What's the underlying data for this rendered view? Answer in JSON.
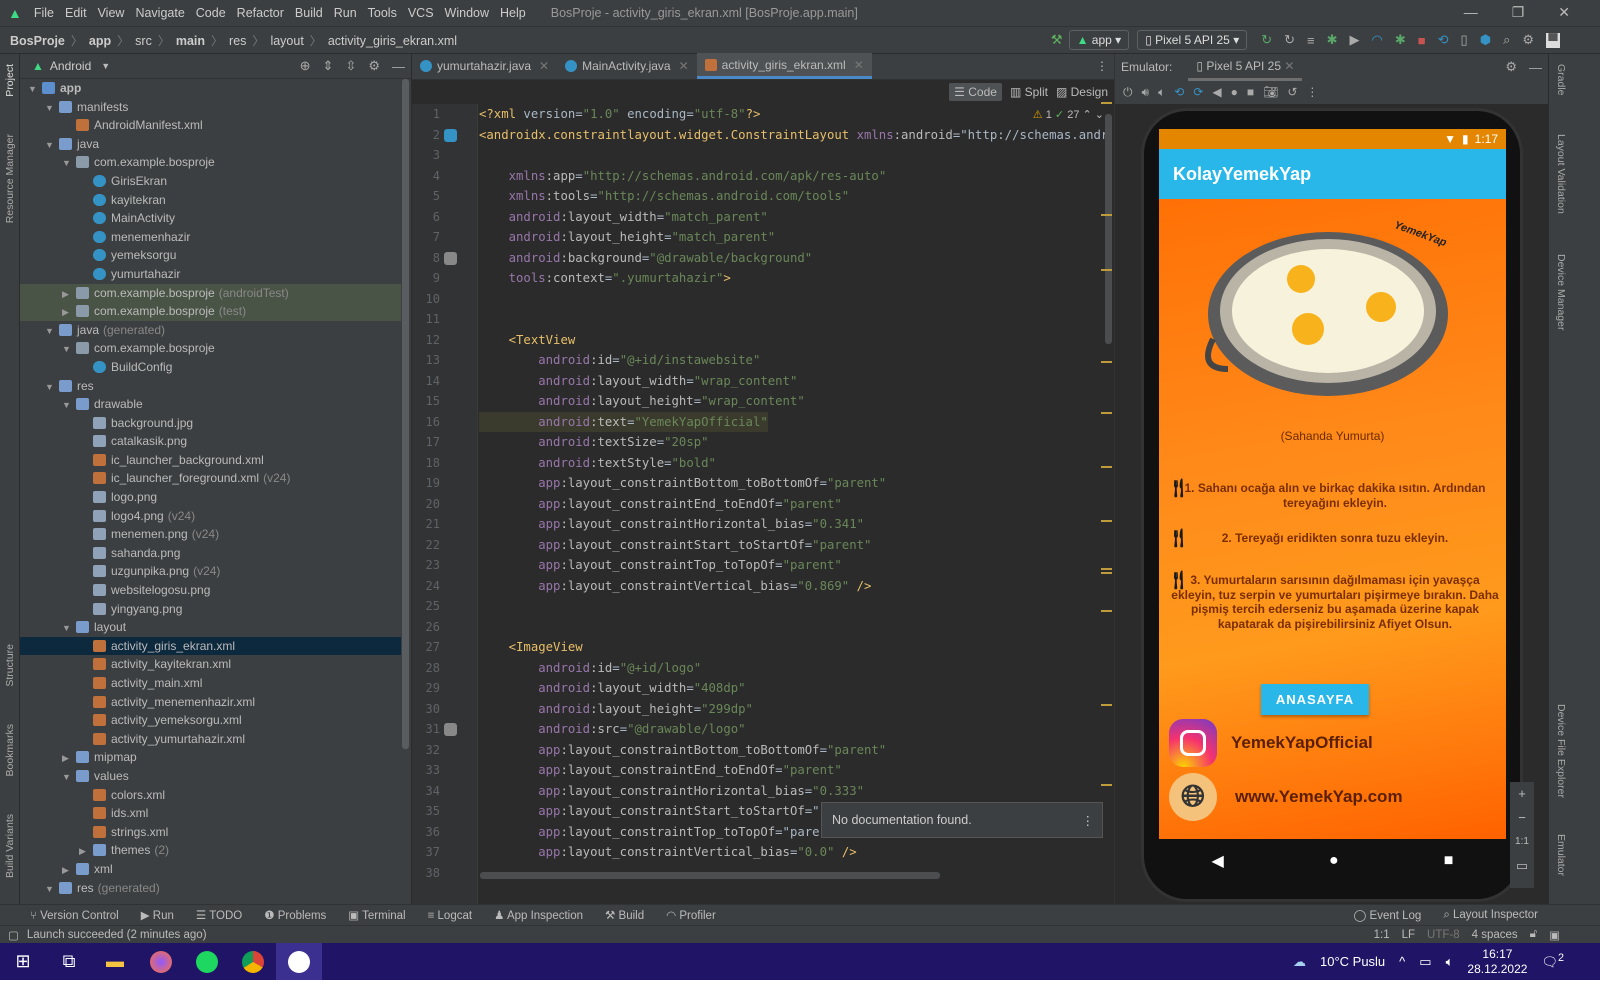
{
  "menu": [
    "File",
    "Edit",
    "View",
    "Navigate",
    "Code",
    "Refactor",
    "Build",
    "Run",
    "Tools",
    "VCS",
    "Window",
    "Help"
  ],
  "window_title": "BosProje - activity_giris_ekran.xml [BosProje.app.main]",
  "breadcrumb": [
    "BosProje",
    "app",
    "src",
    "main",
    "res",
    "layout",
    "activity_giris_ekran.xml"
  ],
  "run_config": "app",
  "device": "Pixel 5 API 25",
  "project_panel": {
    "view": "Android",
    "side_tabs": [
      "Project",
      "Resource Manager",
      "Structure",
      "Bookmarks",
      "Build Variants"
    ]
  },
  "tree": [
    {
      "d": 0,
      "a": "v",
      "t": "app",
      "ic": "module",
      "b": true
    },
    {
      "d": 1,
      "a": "v",
      "t": "manifests",
      "ic": "folder"
    },
    {
      "d": 2,
      "a": "",
      "t": "AndroidManifest.xml",
      "ic": "xml"
    },
    {
      "d": 1,
      "a": "v",
      "t": "java",
      "ic": "folder"
    },
    {
      "d": 2,
      "a": "v",
      "t": "com.example.bosproje",
      "ic": "package"
    },
    {
      "d": 3,
      "a": "",
      "t": "GirisEkran",
      "ic": "class"
    },
    {
      "d": 3,
      "a": "",
      "t": "kayitekran",
      "ic": "class"
    },
    {
      "d": 3,
      "a": "",
      "t": "MainActivity",
      "ic": "class"
    },
    {
      "d": 3,
      "a": "",
      "t": "menemenhazir",
      "ic": "class"
    },
    {
      "d": 3,
      "a": "",
      "t": "yemeksorgu",
      "ic": "class"
    },
    {
      "d": 3,
      "a": "",
      "t": "yumurtahazir",
      "ic": "class"
    },
    {
      "d": 2,
      "a": ">",
      "t": "com.example.bosproje",
      "s": "(androidTest)",
      "ic": "package",
      "test": true
    },
    {
      "d": 2,
      "a": ">",
      "t": "com.example.bosproje",
      "s": "(test)",
      "ic": "package",
      "test": true
    },
    {
      "d": 1,
      "a": "v",
      "t": "java",
      "s": "(generated)",
      "ic": "folder"
    },
    {
      "d": 2,
      "a": "v",
      "t": "com.example.bosproje",
      "ic": "package"
    },
    {
      "d": 3,
      "a": "",
      "t": "BuildConfig",
      "ic": "class"
    },
    {
      "d": 1,
      "a": "v",
      "t": "res",
      "ic": "folder"
    },
    {
      "d": 2,
      "a": "v",
      "t": "drawable",
      "ic": "folder"
    },
    {
      "d": 3,
      "a": "",
      "t": "background.jpg",
      "ic": "image"
    },
    {
      "d": 3,
      "a": "",
      "t": "catalkasik.png",
      "ic": "image"
    },
    {
      "d": 3,
      "a": "",
      "t": "ic_launcher_background.xml",
      "ic": "xml"
    },
    {
      "d": 3,
      "a": "",
      "t": "ic_launcher_foreground.xml",
      "s": "(v24)",
      "ic": "xml"
    },
    {
      "d": 3,
      "a": "",
      "t": "logo.png",
      "ic": "image"
    },
    {
      "d": 3,
      "a": "",
      "t": "logo4.png",
      "s": "(v24)",
      "ic": "image"
    },
    {
      "d": 3,
      "a": "",
      "t": "menemen.png",
      "s": "(v24)",
      "ic": "image"
    },
    {
      "d": 3,
      "a": "",
      "t": "sahanda.png",
      "ic": "image"
    },
    {
      "d": 3,
      "a": "",
      "t": "uzgunpika.png",
      "s": "(v24)",
      "ic": "image"
    },
    {
      "d": 3,
      "a": "",
      "t": "websitelogosu.png",
      "ic": "image"
    },
    {
      "d": 3,
      "a": "",
      "t": "yingyang.png",
      "ic": "image"
    },
    {
      "d": 2,
      "a": "v",
      "t": "layout",
      "ic": "folder"
    },
    {
      "d": 3,
      "a": "",
      "t": "activity_giris_ekran.xml",
      "ic": "xml",
      "sel": true
    },
    {
      "d": 3,
      "a": "",
      "t": "activity_kayitekran.xml",
      "ic": "xml"
    },
    {
      "d": 3,
      "a": "",
      "t": "activity_main.xml",
      "ic": "xml"
    },
    {
      "d": 3,
      "a": "",
      "t": "activity_menemenhazir.xml",
      "ic": "xml"
    },
    {
      "d": 3,
      "a": "",
      "t": "activity_yemeksorgu.xml",
      "ic": "xml"
    },
    {
      "d": 3,
      "a": "",
      "t": "activity_yumurtahazir.xml",
      "ic": "xml"
    },
    {
      "d": 2,
      "a": ">",
      "t": "mipmap",
      "ic": "folder"
    },
    {
      "d": 2,
      "a": "v",
      "t": "values",
      "ic": "folder"
    },
    {
      "d": 3,
      "a": "",
      "t": "colors.xml",
      "ic": "xml"
    },
    {
      "d": 3,
      "a": "",
      "t": "ids.xml",
      "ic": "xml"
    },
    {
      "d": 3,
      "a": "",
      "t": "strings.xml",
      "ic": "xml"
    },
    {
      "d": 3,
      "a": ">",
      "t": "themes",
      "s": "(2)",
      "ic": "folder"
    },
    {
      "d": 2,
      "a": ">",
      "t": "xml",
      "ic": "folder"
    },
    {
      "d": 1,
      "a": "v",
      "t": "res",
      "s": "(generated)",
      "ic": "folder"
    }
  ],
  "editor_tabs": [
    {
      "label": "yumurtahazir.java",
      "type": "class"
    },
    {
      "label": "MainActivity.java",
      "type": "class"
    },
    {
      "label": "activity_giris_ekran.xml",
      "type": "xml",
      "active": true
    }
  ],
  "view_modes": {
    "code": "Code",
    "split": "Split",
    "design": "Design",
    "selected": "Code"
  },
  "inspections": {
    "warnings": "1",
    "ok": "27"
  },
  "code_lines": [
    "<?xml version=\"1.0\" encoding=\"utf-8\"?>",
    "<androidx.constraintlayout.widget.ConstraintLayout xmlns:android=\"http://schemas.andr",
    "",
    "    xmlns:app=\"http://schemas.android.com/apk/res-auto\"",
    "    xmlns:tools=\"http://schemas.android.com/tools\"",
    "    android:layout_width=\"match_parent\"",
    "    android:layout_height=\"match_parent\"",
    "    android:background=\"@drawable/background\"",
    "    tools:context=\".yumurtahazir\">",
    "",
    "",
    "    <TextView",
    "        android:id=\"@+id/instawebsite\"",
    "        android:layout_width=\"wrap_content\"",
    "        android:layout_height=\"wrap_content\"",
    "        android:text=\"YemekYapOfficial\"",
    "        android:textSize=\"20sp\"",
    "        android:textStyle=\"bold\"",
    "        app:layout_constraintBottom_toBottomOf=\"parent\"",
    "        app:layout_constraintEnd_toEndOf=\"parent\"",
    "        app:layout_constraintHorizontal_bias=\"0.341\"",
    "        app:layout_constraintStart_toStartOf=\"parent\"",
    "        app:layout_constraintTop_toTopOf=\"parent\"",
    "        app:layout_constraintVertical_bias=\"0.869\" />",
    "",
    "",
    "    <ImageView",
    "        android:id=\"@+id/logo\"",
    "        android:layout_width=\"408dp\"",
    "        android:layout_height=\"299dp\"",
    "        android:src=\"@drawable/logo\"",
    "        app:layout_constraintBottom_toBottomOf=\"parent\"",
    "        app:layout_constraintEnd_toEndOf=\"parent\"",
    "        app:layout_constraintHorizontal_bias=\"0.333\"",
    "        app:layout_constraintStart_toStartOf=\"",
    "        app:layout_constraintTop_toTopOf=\"pare",
    "        app:layout_constraintVertical_bias=\"0.0\" />",
    ""
  ],
  "tooltip": "No documentation found.",
  "emulator": {
    "label": "Emulator:",
    "tab": "Pixel 5 API 25",
    "zoom_label": "1:1"
  },
  "phone": {
    "time": "1:17",
    "app_title": "KolayYemekYap",
    "logo_text": "YemekYap",
    "caption": "(Sahanda Yumurta)",
    "steps": [
      "1. Sahanı ocağa alın ve birkaç dakika ısıtın. Ardından tereyağını ekleyin.",
      "2. Tereyağı eridikten sonra tuzu ekleyin.",
      "3. Yumurtaların sarısının dağılmaması için yavaşça ekleyin, tuz serpin ve yumurtaları pişirmeye bırakın. Daha pişmiş tercih ederseniz bu aşamada üzerine kapak kapatarak da pişirebilirsiniz Afiyet Olsun."
    ],
    "home_button": "ANASAYFA",
    "instagram": "YemekYapOfficial",
    "website": "www.YemekYap.com"
  },
  "right_tabs": [
    "Gradle",
    "Layout Validation",
    "Device Manager",
    "Device File Explorer",
    "Emulator"
  ],
  "bottom_tools": [
    "Version Control",
    "Run",
    "TODO",
    "Problems",
    "Terminal",
    "Logcat",
    "App Inspection",
    "Build",
    "Profiler"
  ],
  "bottom_right_tools": [
    "Event Log",
    "Layout Inspector"
  ],
  "status": {
    "message": "Launch succeeded (2 minutes ago)",
    "position": "1:1",
    "line_sep": "LF",
    "encoding": "UTF-8",
    "indent": "4 spaces"
  },
  "taskbar": {
    "weather": "10°C  Puslu",
    "time": "16:17",
    "date": "28.12.2022",
    "notifications": "2"
  },
  "colors": {
    "accent": "#29b6e9",
    "status_orange": "#e58600",
    "selection": "#0d293e"
  }
}
